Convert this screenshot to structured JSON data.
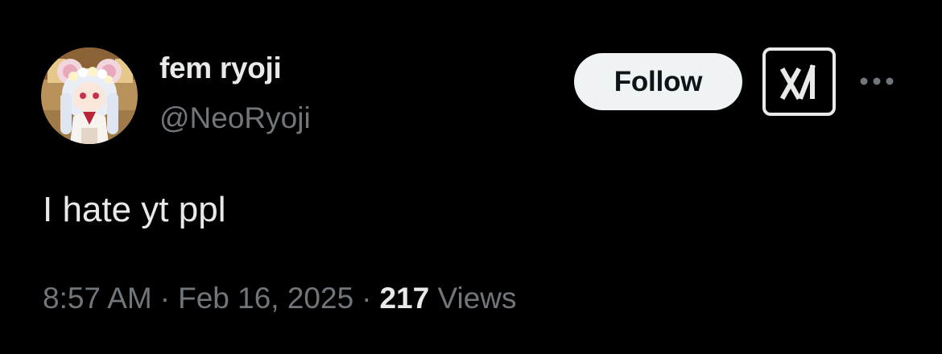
{
  "tweet": {
    "author": {
      "display_name": "fem ryoji",
      "handle": "@NeoRyoji",
      "avatar_icon": "anime-character-avatar"
    },
    "follow_label": "Follow",
    "grok_icon": "grok-icon",
    "more_icon": "more-dots-icon",
    "text": "I hate yt ppl",
    "time": "8:57 AM",
    "separator": "·",
    "date": "Feb 16, 2025",
    "views_count": "217",
    "views_label": "Views"
  },
  "colors": {
    "background": "#000000",
    "primary_text": "#e7e9ea",
    "secondary_text": "#71767b",
    "follow_bg": "#eff3f4",
    "follow_text": "#0f1419"
  }
}
